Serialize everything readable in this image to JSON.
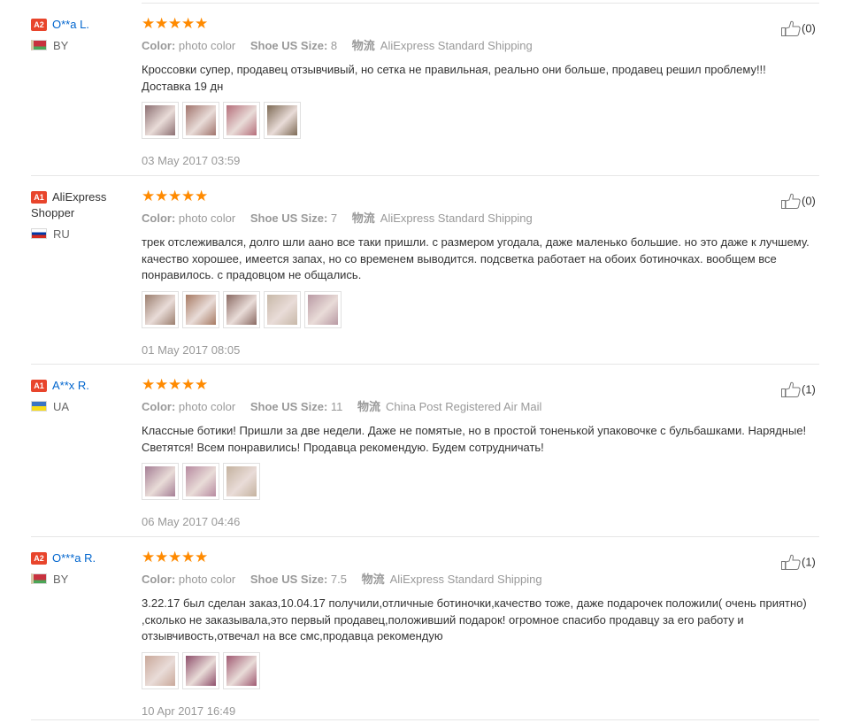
{
  "labels": {
    "color": "Color:",
    "size": "Shoe US Size:",
    "shipping": "物流"
  },
  "colors": {
    "accent_star": "#ff8a00",
    "badge": "#e8452c",
    "link": "#0065ce"
  },
  "reviews": [
    {
      "badge": "A2",
      "name": "O**a L.",
      "country": "BY",
      "flag": "flag-by",
      "stars": 5,
      "color_value": "photo color",
      "size_value": "8",
      "shipping_value": "AliExpress Standard Shipping",
      "text": "Кроссовки супер, продавец отзывчивый, но сетка не правильная, реально они больше, продавец решил проблему!!! Доставка 19 дн",
      "photos": [
        "#8c6f72",
        "#a0736c",
        "#b56e7a",
        "#7d6a55"
      ],
      "date": "03 May 2017 03:59",
      "helpful": "(0)"
    },
    {
      "badge": "A1",
      "name": "AliExpress Shopper",
      "country": "RU",
      "flag": "flag-ru",
      "stars": 5,
      "color_value": "photo color",
      "size_value": "7",
      "shipping_value": "AliExpress Standard Shipping",
      "text": "трек отслеживался, долго шли аано все таки пришли. с размером угодала, даже маленько большие. но это даже к лучшему. качество хорошее, имеется запах, но со временем выводится. подсветка работает на обоих ботиночках. вообщем все понравилось. с прадовцом не общались.",
      "photos": [
        "#9b7e6e",
        "#a77a63",
        "#8a6a63",
        "#c7b8a8",
        "#b99aa4"
      ],
      "date": "01 May 2017 08:05",
      "helpful": "(0)"
    },
    {
      "badge": "A1",
      "name": "A**x R.",
      "country": "UA",
      "flag": "flag-ua",
      "stars": 5,
      "color_value": "photo color",
      "size_value": "11",
      "shipping_value": "China Post Registered Air Mail",
      "text": "Классные ботики! Пришли за две недели. Даже не помятые, но в простой тоненькой упаковочке с бульбашками. Нарядные! Светятся! Всем понравились! Продавца рекомендую. Будем сотрудничать!",
      "photos": [
        "#a57e95",
        "#b78aa0",
        "#c4b29f"
      ],
      "date": "06 May 2017 04:46",
      "helpful": "(1)"
    },
    {
      "badge": "A2",
      "name": "O***a R.",
      "country": "BY",
      "flag": "flag-by",
      "stars": 5,
      "color_value": "photo color",
      "size_value": "7.5",
      "shipping_value": "AliExpress Standard Shipping",
      "text": "3.22.17 был сделан заказ,10.04.17 получили,отличные ботиночки,качество тоже, даже подарочек положили( очень приятно) ,сколько не заказывала,это первый продавец,положивший подарок! огромное спасибо продавцу за его работу и отзывчивость,отвечал на все смс,продавца рекомендую",
      "photos": [
        "#c9a89a",
        "#8e4f6b",
        "#a05a72"
      ],
      "date": "10 Apr 2017 16:49",
      "helpful": "(1)"
    }
  ]
}
